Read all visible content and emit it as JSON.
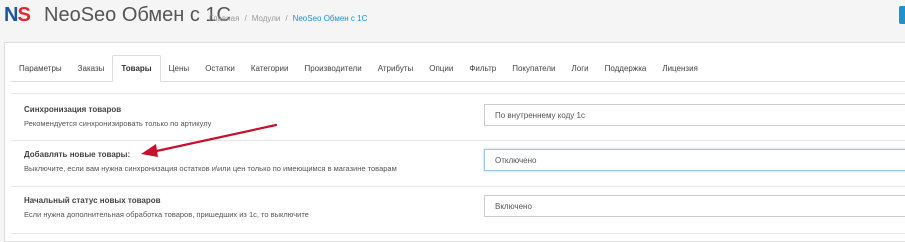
{
  "app": {
    "logo_n": "N",
    "logo_s": "S",
    "title": "NeoSeo Обмен с 1С"
  },
  "breadcrumb": [
    "Главная",
    "Модули",
    "NeoSeo Обмен с 1С"
  ],
  "breadcrumb_sep": "/",
  "tabs": [
    "Параметры",
    "Заказы",
    "Товары",
    "Цены",
    "Остатки",
    "Категории",
    "Производители",
    "Атрибуты",
    "Опции",
    "Фильтр",
    "Покупатели",
    "Логи",
    "Поддержка",
    "Лицензия"
  ],
  "active_tab": "Товары",
  "settings": [
    {
      "label": "Синхронизация товаров",
      "desc": "Рекомендуется синхронизировать только по артикулу",
      "value": "По внутреннему коду 1с"
    },
    {
      "label": "Добавлять новые товары:",
      "desc": "Выключите, если вам нужна синхронизация остатков и\\или цен только по имеющимся в магазине товарам",
      "value": "Отключено"
    },
    {
      "label": "Начальный статус новых товаров",
      "desc": "Если нужна дополнительная обработка товаров, пришедших из 1с, то выключите",
      "value": "Включено"
    }
  ],
  "colors": {
    "accent": "#1e91cf",
    "logo_blue": "#1e5799",
    "logo_red": "#e4252b",
    "annotation_arrow": "#c8102e"
  }
}
